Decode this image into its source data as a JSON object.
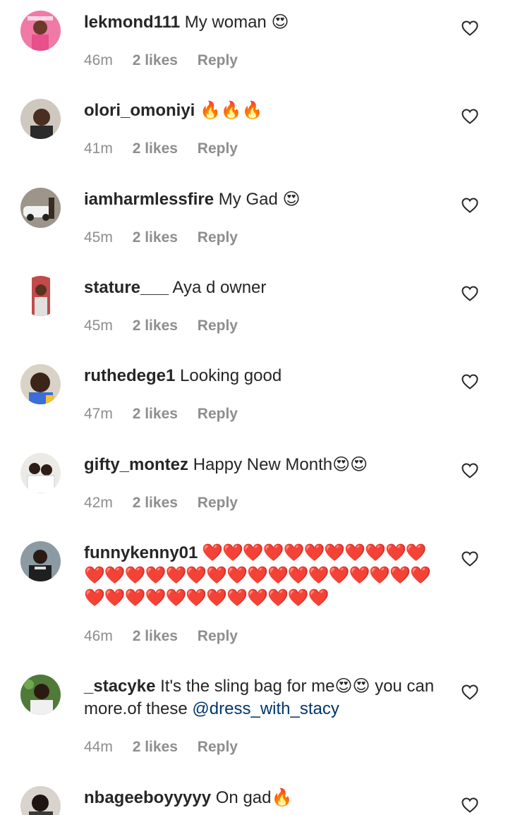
{
  "comments": [
    {
      "username": "lekmond111",
      "text": "My woman 😍",
      "time": "46m",
      "likes": "2 likes",
      "reply": "Reply"
    },
    {
      "username": "olori_omoniyi",
      "text": "🔥🔥🔥",
      "time": "41m",
      "likes": "2 likes",
      "reply": "Reply"
    },
    {
      "username": "iamharmlessfire",
      "text": "My Gad 😍",
      "time": "45m",
      "likes": "2 likes",
      "reply": "Reply"
    },
    {
      "username": "stature___",
      "text": "Aya d owner",
      "time": "45m",
      "likes": "2 likes",
      "reply": "Reply"
    },
    {
      "username": "ruthedege1",
      "text": "Looking good",
      "time": "47m",
      "likes": "2 likes",
      "reply": "Reply"
    },
    {
      "username": "gifty_montez",
      "text": "Happy New Month😍😍",
      "time": "42m",
      "likes": "2 likes",
      "reply": "Reply"
    },
    {
      "username": "funnykenny01",
      "text": "❤️❤️❤️❤️❤️❤️❤️❤️❤️❤️❤️❤️❤️❤️❤️❤️❤️❤️❤️❤️❤️❤️❤️❤️❤️❤️❤️❤️❤️❤️❤️❤️❤️❤️❤️❤️❤️❤️❤️❤️",
      "time": "46m",
      "likes": "2 likes",
      "reply": "Reply"
    },
    {
      "username": "_stacyke",
      "text": "It's the sling bag for me😍😍 you can more.of these",
      "mention": "@dress_with_stacy",
      "time": "44m",
      "likes": "2 likes",
      "reply": "Reply"
    },
    {
      "username": "nbageeboyyyyy",
      "text": "On gad🔥",
      "time": "",
      "likes": "",
      "reply": ""
    }
  ],
  "colors": {
    "meta": "#8e8e8e",
    "text": "#262626",
    "mention": "#00376b"
  },
  "icons": {
    "like": "heart-outline-icon"
  }
}
